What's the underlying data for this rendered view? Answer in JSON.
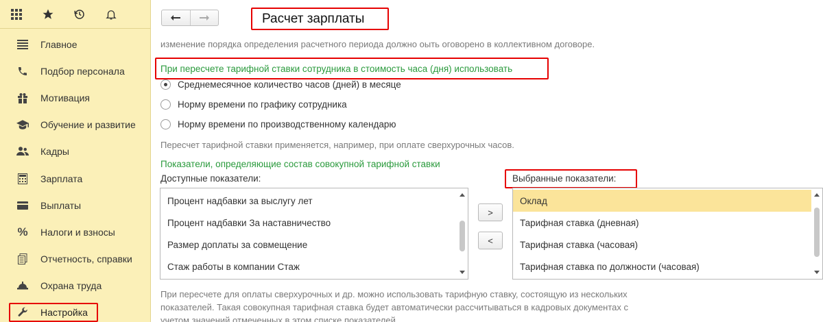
{
  "sidebar": {
    "top_icons": [
      "apps-grid-icon",
      "star-icon",
      "history-icon",
      "bell-icon"
    ],
    "items": [
      {
        "label": "Главное",
        "icon": "menu-lines-icon"
      },
      {
        "label": "Подбор персонала",
        "icon": "phone-icon"
      },
      {
        "label": "Мотивация",
        "icon": "gift-icon"
      },
      {
        "label": "Обучение и развитие",
        "icon": "graduation-cap-icon"
      },
      {
        "label": "Кадры",
        "icon": "people-icon"
      },
      {
        "label": "Зарплата",
        "icon": "calculator-icon"
      },
      {
        "label": "Выплаты",
        "icon": "wallet-icon"
      },
      {
        "label": "Налоги и взносы",
        "icon": "percent-icon"
      },
      {
        "label": "Отчетность, справки",
        "icon": "reports-icon"
      },
      {
        "label": "Охрана труда",
        "icon": "helmet-icon"
      },
      {
        "label": "Настройка",
        "icon": "wrench-icon"
      }
    ],
    "active_index": 10
  },
  "header": {
    "title": "Расчет зарплаты",
    "back_glyph": "🡐",
    "forward_glyph": "🡒"
  },
  "main": {
    "top_note": "изменение порядка определения расчетного периода должно оыть оговорено в коллективном договоре.",
    "rate_heading": "При пересчете тарифной ставки сотрудника в стоимость часа (дня) использовать",
    "radio_options": [
      {
        "label": "Среднемесячное количество часов (дней) в месяце",
        "checked": true
      },
      {
        "label": "Норму времени по графику сотрудника",
        "checked": false
      },
      {
        "label": "Норму времени по производственному календарю",
        "checked": false
      }
    ],
    "rate_note": "Пересчет тарифной ставки применяется, например, при оплате сверхурочных часов.",
    "indicators_heading": "Показатели, определяющие состав совокупной тарифной ставки",
    "available_label": "Доступные показатели:",
    "selected_label": "Выбранные показатели:",
    "available_items": [
      "Процент надбавки за выслугу лет",
      "Процент надбавки За наставничество",
      "Размер доплаты за совмещение",
      "Стаж работы в компании Стаж"
    ],
    "selected_items": [
      "Оклад",
      "Тарифная ставка (дневная)",
      "Тарифная ставка (часовая)",
      "Тарифная ставка по должности (часовая)"
    ],
    "selected_row_index": 0,
    "add_button": ">",
    "remove_button": "<",
    "bottom_note": [
      "При пересчете для оплаты сверхурочных и др. можно использовать тарифную ставку, состоящую из нескольких",
      "показателей. Такая совокупная тарифная ставка будет автоматически рассчитываться в кадровых документах с",
      "учетом значений отмеченных в этом списке показателей"
    ]
  },
  "colors": {
    "sidebar_bg": "#fbf0b8",
    "highlight_red": "#e60000",
    "heading_green": "#2a9a3c",
    "selected_row": "#fbe49a"
  }
}
